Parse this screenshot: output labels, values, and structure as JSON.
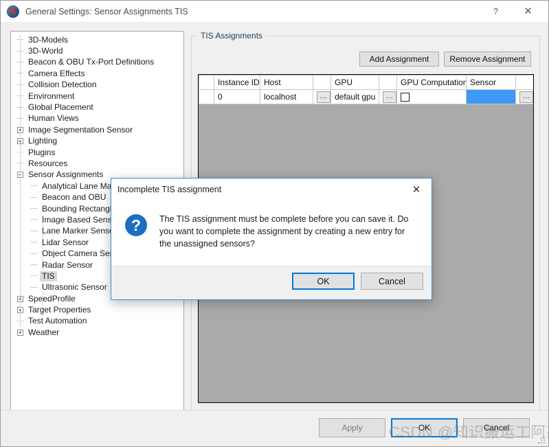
{
  "window": {
    "title": "General Settings: Sensor Assignments TIS",
    "icon": "app-globe-icon",
    "help_label": "?",
    "close_label": "✕"
  },
  "sidebar": {
    "items": [
      {
        "label": "3D-Models",
        "level": 1,
        "glyph": "leaf"
      },
      {
        "label": "3D-World",
        "level": 1,
        "glyph": "leaf"
      },
      {
        "label": "Beacon & OBU Tx-Port Definitions",
        "level": 1,
        "glyph": "leaf"
      },
      {
        "label": "Camera Effects",
        "level": 1,
        "glyph": "leaf"
      },
      {
        "label": "Collision Detection",
        "level": 1,
        "glyph": "leaf"
      },
      {
        "label": "Environment",
        "level": 1,
        "glyph": "leaf"
      },
      {
        "label": "Global Placement",
        "level": 1,
        "glyph": "leaf"
      },
      {
        "label": "Human Views",
        "level": 1,
        "glyph": "leaf"
      },
      {
        "label": "Image Segmentation Sensor",
        "level": 1,
        "glyph": "plus"
      },
      {
        "label": "Lighting",
        "level": 1,
        "glyph": "plus"
      },
      {
        "label": "Plugins",
        "level": 1,
        "glyph": "leaf"
      },
      {
        "label": "Resources",
        "level": 1,
        "glyph": "leaf"
      },
      {
        "label": "Sensor Assignments",
        "level": 1,
        "glyph": "minus"
      },
      {
        "label": "Analytical Lane Marker Sensor",
        "level": 2,
        "glyph": "leaf"
      },
      {
        "label": "Beacon and OBU",
        "level": 2,
        "glyph": "leaf"
      },
      {
        "label": "Bounding Rectangle Sensor",
        "level": 2,
        "glyph": "leaf"
      },
      {
        "label": "Image Based Sensor",
        "level": 2,
        "glyph": "leaf"
      },
      {
        "label": "Lane Marker Sensor",
        "level": 2,
        "glyph": "leaf"
      },
      {
        "label": "Lidar Sensor",
        "level": 2,
        "glyph": "leaf"
      },
      {
        "label": "Object Camera Sensor",
        "level": 2,
        "glyph": "leaf"
      },
      {
        "label": "Radar Sensor",
        "level": 2,
        "glyph": "leaf"
      },
      {
        "label": "TIS",
        "level": 2,
        "glyph": "leaf",
        "selected": true
      },
      {
        "label": "Ultrasonic Sensor",
        "level": 2,
        "glyph": "leaf"
      },
      {
        "label": "SpeedProfile",
        "level": 1,
        "glyph": "plus"
      },
      {
        "label": "Target Properties",
        "level": 1,
        "glyph": "plus"
      },
      {
        "label": "Test Automation",
        "level": 1,
        "glyph": "leaf"
      },
      {
        "label": "Weather",
        "level": 1,
        "glyph": "plus"
      }
    ]
  },
  "main": {
    "group_title": "TIS Assignments",
    "add_assignment_label": "Add Assignment",
    "remove_assignment_label": "Remove Assignment",
    "table": {
      "columns": [
        "",
        "Instance ID",
        "Host",
        "",
        "GPU",
        "",
        "GPU Computation",
        "Sensor",
        ""
      ],
      "rows": [
        {
          "instance_id": "0",
          "host": "localhost",
          "host_browse": "...",
          "gpu": "default gpu",
          "gpu_browse": "...",
          "gpu_computation_checked": false,
          "sensor": "",
          "sensor_browse": "..."
        }
      ]
    }
  },
  "footer": {
    "apply_label": "Apply",
    "ok_label": "OK",
    "cancel_label": "Cancel"
  },
  "dialog": {
    "title": "Incomplete TIS assignment",
    "close_label": "✕",
    "icon": "question-mark-icon",
    "icon_glyph": "?",
    "message": "The TIS assignment must be complete before you can save it. Do you want to complete the assignment by creating a new entry for the unassigned sensors?",
    "ok_label": "OK",
    "cancel_label": "Cancel"
  },
  "watermark": {
    "text": "CSDN @知识搬运工阿杰"
  },
  "colors": {
    "accent": "#0078d7",
    "sensor_cell": "#3d99f5",
    "table_background": "#aaaaaa",
    "window_background": "#f0f0f0"
  }
}
